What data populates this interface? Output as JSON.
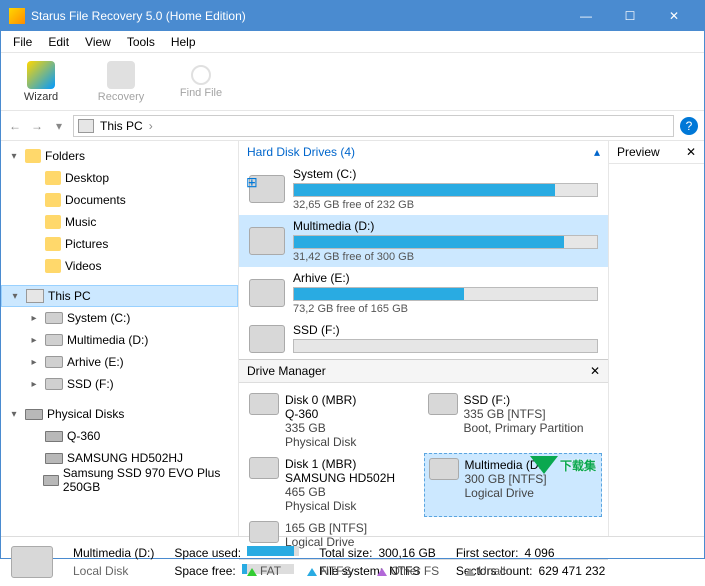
{
  "titlebar": {
    "title": "Starus File Recovery 5.0 (Home Edition)"
  },
  "menu": {
    "file": "File",
    "edit": "Edit",
    "view": "View",
    "tools": "Tools",
    "help": "Help"
  },
  "toolbar": {
    "wizard": "Wizard",
    "recovery": "Recovery",
    "findfile": "Find File"
  },
  "nav": {
    "location": "This PC"
  },
  "sidebar": {
    "folders": {
      "label": "Folders",
      "items": [
        {
          "label": "Desktop"
        },
        {
          "label": "Documents"
        },
        {
          "label": "Music"
        },
        {
          "label": "Pictures"
        },
        {
          "label": "Videos"
        }
      ]
    },
    "thispc": {
      "label": "This PC",
      "items": [
        {
          "label": "System (C:)"
        },
        {
          "label": "Multimedia (D:)"
        },
        {
          "label": "Arhive (E:)"
        },
        {
          "label": "SSD (F:)"
        }
      ]
    },
    "physical": {
      "label": "Physical Disks",
      "items": [
        {
          "label": "Q-360"
        },
        {
          "label": "SAMSUNG HD502HJ"
        },
        {
          "label": "Samsung SSD 970 EVO Plus 250GB"
        }
      ]
    }
  },
  "drives": {
    "header": "Hard Disk Drives (4)",
    "list": [
      {
        "name": "System (C:)",
        "free": "32,65 GB free of 232 GB",
        "fill": 86,
        "win": true
      },
      {
        "name": "Multimedia (D:)",
        "free": "31,42 GB free of 300 GB",
        "fill": 89,
        "sel": true
      },
      {
        "name": "Arhive (E:)",
        "free": "73,2 GB free of 165 GB",
        "fill": 56
      },
      {
        "name": "SSD (F:)",
        "free": "",
        "fill": 0
      }
    ]
  },
  "dm": {
    "title": "Drive Manager",
    "disks": [
      {
        "name": "Disk 0 (MBR)",
        "model": "Q-360",
        "size": "335 GB",
        "type": "Physical Disk"
      },
      {
        "name": "SSD (F:)",
        "model": "",
        "size": "335 GB [NTFS]",
        "type": "Boot, Primary Partition"
      },
      {
        "name": "Disk 1 (MBR)",
        "model": "SAMSUNG HD502H",
        "size": "465 GB",
        "type": "Physical Disk"
      },
      {
        "name": "Multimedia (D:)",
        "model": "",
        "size": "300 GB [NTFS]",
        "type": "Logical Drive",
        "sel": true
      },
      {
        "name": "",
        "model": "",
        "size": "165 GB [NTFS]",
        "type": "Logical Drive"
      }
    ],
    "legend": {
      "fat": "FAT",
      "ntfs": "NTFS",
      "other": "Other FS",
      "unalloc": "Unallo"
    }
  },
  "preview": {
    "title": "Preview"
  },
  "status": {
    "name": "Multimedia (D:)",
    "type": "Local Disk",
    "used_label": "Space used:",
    "free_label": "Space free:",
    "total_label": "Total size:",
    "total": "300,16 GB",
    "fs_label": "File system:",
    "fs": "NTFS",
    "firstsec_label": "First sector:",
    "firstsec": "4 096",
    "seccount_label": "Sectors count:",
    "seccount": "629 471 232"
  },
  "watermark": "下载集"
}
